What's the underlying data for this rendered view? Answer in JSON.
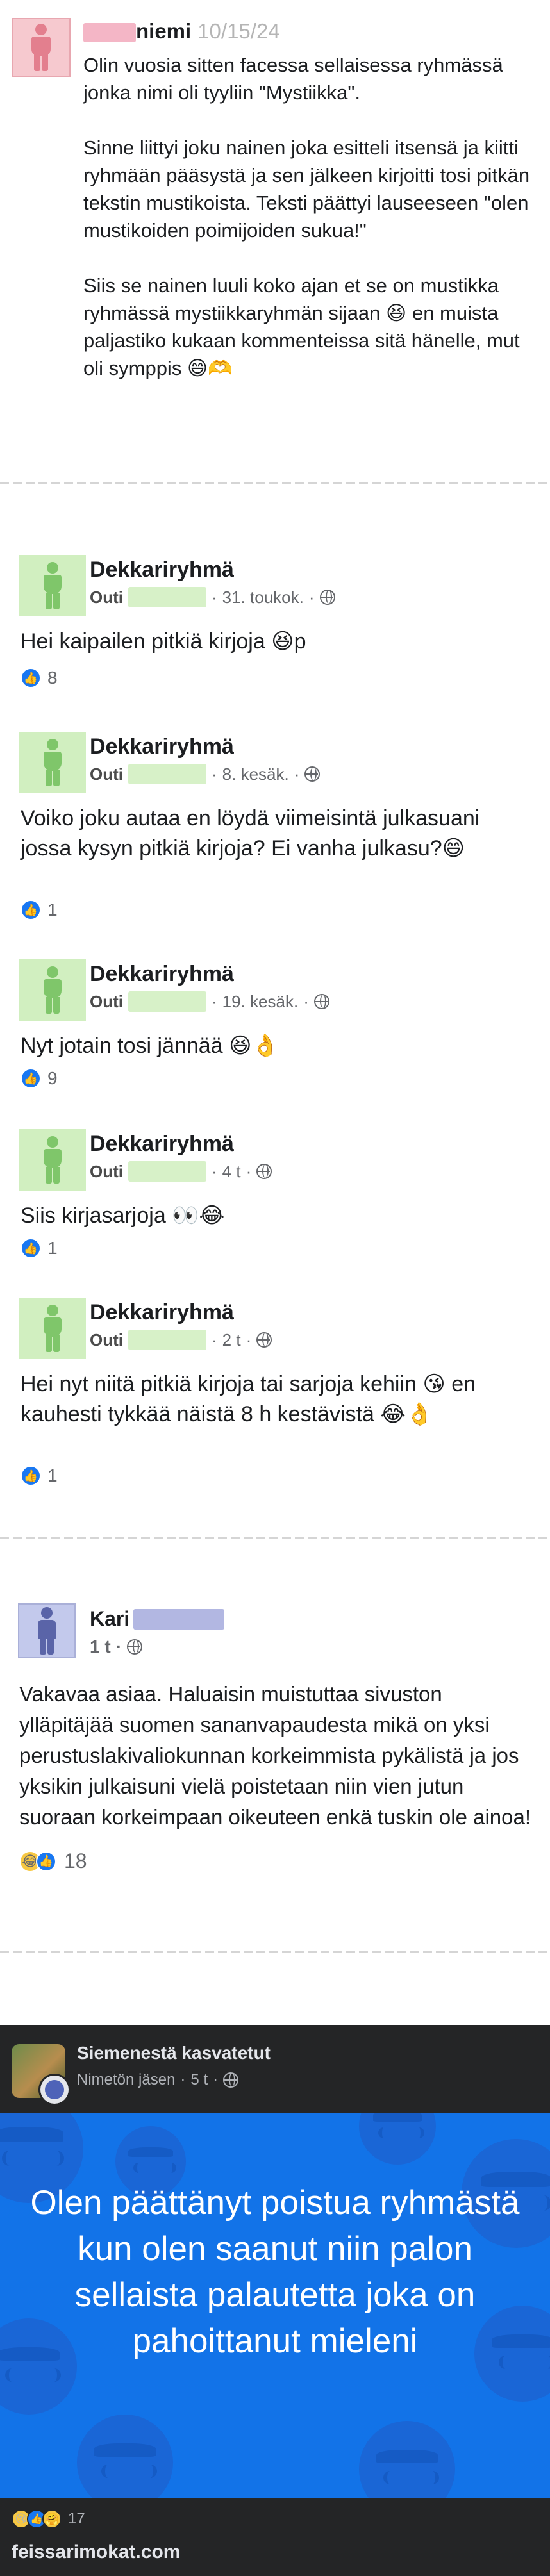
{
  "post1": {
    "name_suffix": "niemi",
    "date": "10/15/24",
    "paragraphs": [
      "Olin vuosia sitten facessa sellaisessa ryhmässä jonka nimi oli tyyliin \"Mystiikka\".",
      "Sinne liittyi joku nainen joka esitteli itsensä ja kiitti ryhmään pääsystä ja sen jälkeen kirjoitti tosi pitkän tekstin mustikoista. Teksti päättyi lauseeseen \"olen mustikoiden poimijoiden sukua!\"",
      "Siis se nainen luuli koko ajan et se on mustikka ryhmässä mystiikkaryhmän sijaan 😆 en muista paljastiko kukaan kommenteissa sitä hänelle, mut oli symppis 😄🫶"
    ]
  },
  "group_posts": [
    {
      "group": "Dekkariryhmä",
      "author": "Outi",
      "time": "31. toukok.",
      "text": "Hei kaipailen pitkiä kirjoja 😆p",
      "reactions": "8"
    },
    {
      "group": "Dekkariryhmä",
      "author": "Outi",
      "time": "8. kesäk.",
      "text": "Voiko joku autaa en löydä viimeisintä julkasuani jossa kysyn pitkiä kirjoja? Ei vanha julkasu?😄",
      "reactions": "1"
    },
    {
      "group": "Dekkariryhmä",
      "author": "Outi",
      "time": "19. kesäk.",
      "text": "Nyt jotain tosi jännää 😆👌",
      "reactions": "9"
    },
    {
      "group": "Dekkariryhmä",
      "author": "Outi",
      "time": "4 t",
      "text": "Siis kirjasarjoja 👀😂",
      "reactions": "1"
    },
    {
      "group": "Dekkariryhmä",
      "author": "Outi",
      "time": "2 t",
      "text": "Hei nyt niitä pitkiä  kirjoja tai sarjoja kehiin 😘 en kauhesti tykkää  näistä 8 h kestävistä 😂👌",
      "reactions": "1"
    }
  ],
  "post3": {
    "name": "Kari",
    "time": "1 t",
    "text": "Vakavaa asiaa. Haluaisin muistuttaa sivuston ylläpitäjää suomen sananvapaudesta mikä on yksi perustuslakivaliokunnan korkeimmista pykälistä ja jos yksikin julkaisuni vielä poistetaan niin vien jutun suoraan korkeimpaan oikeuteen enkä tuskin ole ainoa!",
    "reactions": "18"
  },
  "post4": {
    "group": "Siemenestä kasvatetut",
    "author": "Nimetön jäsen",
    "time": "5 t",
    "message": "Olen päättänyt poistua ryhmästä kun olen saanut niin palon sellaista palautetta joka on pahoittanut mieleni",
    "reactions": "17",
    "watermark": "feissarimokat.com"
  },
  "icons": {
    "like": "thumbs-up-icon",
    "haha": "laughing-face-icon",
    "sad": "sad-face-icon",
    "care": "care-hug-icon",
    "privacy": "globe-icon",
    "avatar": "person-silhouette-icon",
    "anonymous": "incognito-ghost-icon"
  },
  "colors": {
    "fb_blue": "#1877f2",
    "dark_bar": "#242526",
    "card_blue": "#1273e8",
    "avatar_pink": "#f6c9cf",
    "avatar_green": "#d1efc0",
    "avatar_lavender": "#c3c9ec"
  }
}
